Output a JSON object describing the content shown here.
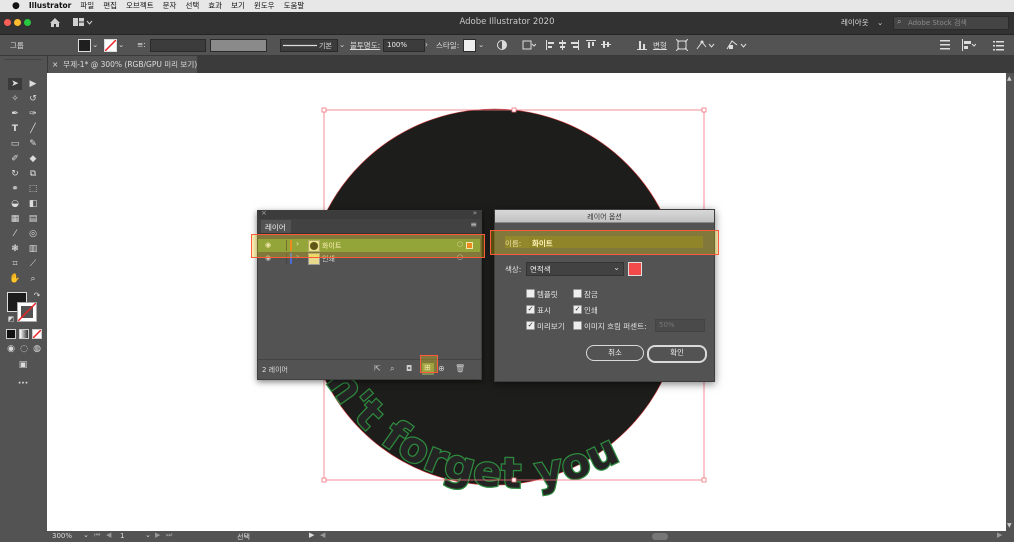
{
  "menubar": {
    "apple_icon": "apple-icon",
    "items": [
      "Illustrator",
      "파일",
      "편집",
      "오브젝트",
      "문자",
      "선택",
      "효과",
      "보기",
      "윈도우",
      "도움말"
    ]
  },
  "titlebar": {
    "title": "Adobe Illustrator 2020",
    "workspace": "레이아웃",
    "stock_search_placeholder": "Adobe Stock 검색"
  },
  "control_bar": {
    "selection_label": "그룹",
    "stroke_style": "기본",
    "opacity_label": "불투명도:",
    "opacity_value": "100%",
    "style_label": "스타일:",
    "transform_label": "변형"
  },
  "document_tab": {
    "title": "무제-1* @ 300% (RGB/GPU 미리 보기)"
  },
  "status_bar": {
    "zoom": "300%",
    "artboard_num": "1",
    "tool_label": "선택"
  },
  "artwork": {
    "curved_text": "Don't forget you"
  },
  "layers_panel": {
    "tab_label": "레이어",
    "layers": [
      {
        "name": "화이트",
        "color": "#e56b2a",
        "selected": true
      },
      {
        "name": "인쇄",
        "color": "#4a6bd8",
        "selected": false
      }
    ],
    "footer_count": "2 레이어"
  },
  "layer_options": {
    "title": "레이어 옵션",
    "name_label": "이름:",
    "name_value": "화이트",
    "color_label": "색상:",
    "color_value": "연적색",
    "color_swatch": "#f24a4a",
    "checkbox_template": "템플릿",
    "checkbox_lock": "잠금",
    "checkbox_show": "표시",
    "checkbox_print": "인쇄",
    "checkbox_preview": "미리보기",
    "checkbox_dim": "이미지 흐림 퍼센트:",
    "dim_value": "50%",
    "cancel_label": "취소",
    "ok_label": "확인"
  },
  "colors": {
    "ui_bg": "#535353",
    "highlight_border": "#ff5a3c",
    "layer_selected_bg": "#6a8f4e",
    "text_stroke": "#2e8a3e"
  }
}
